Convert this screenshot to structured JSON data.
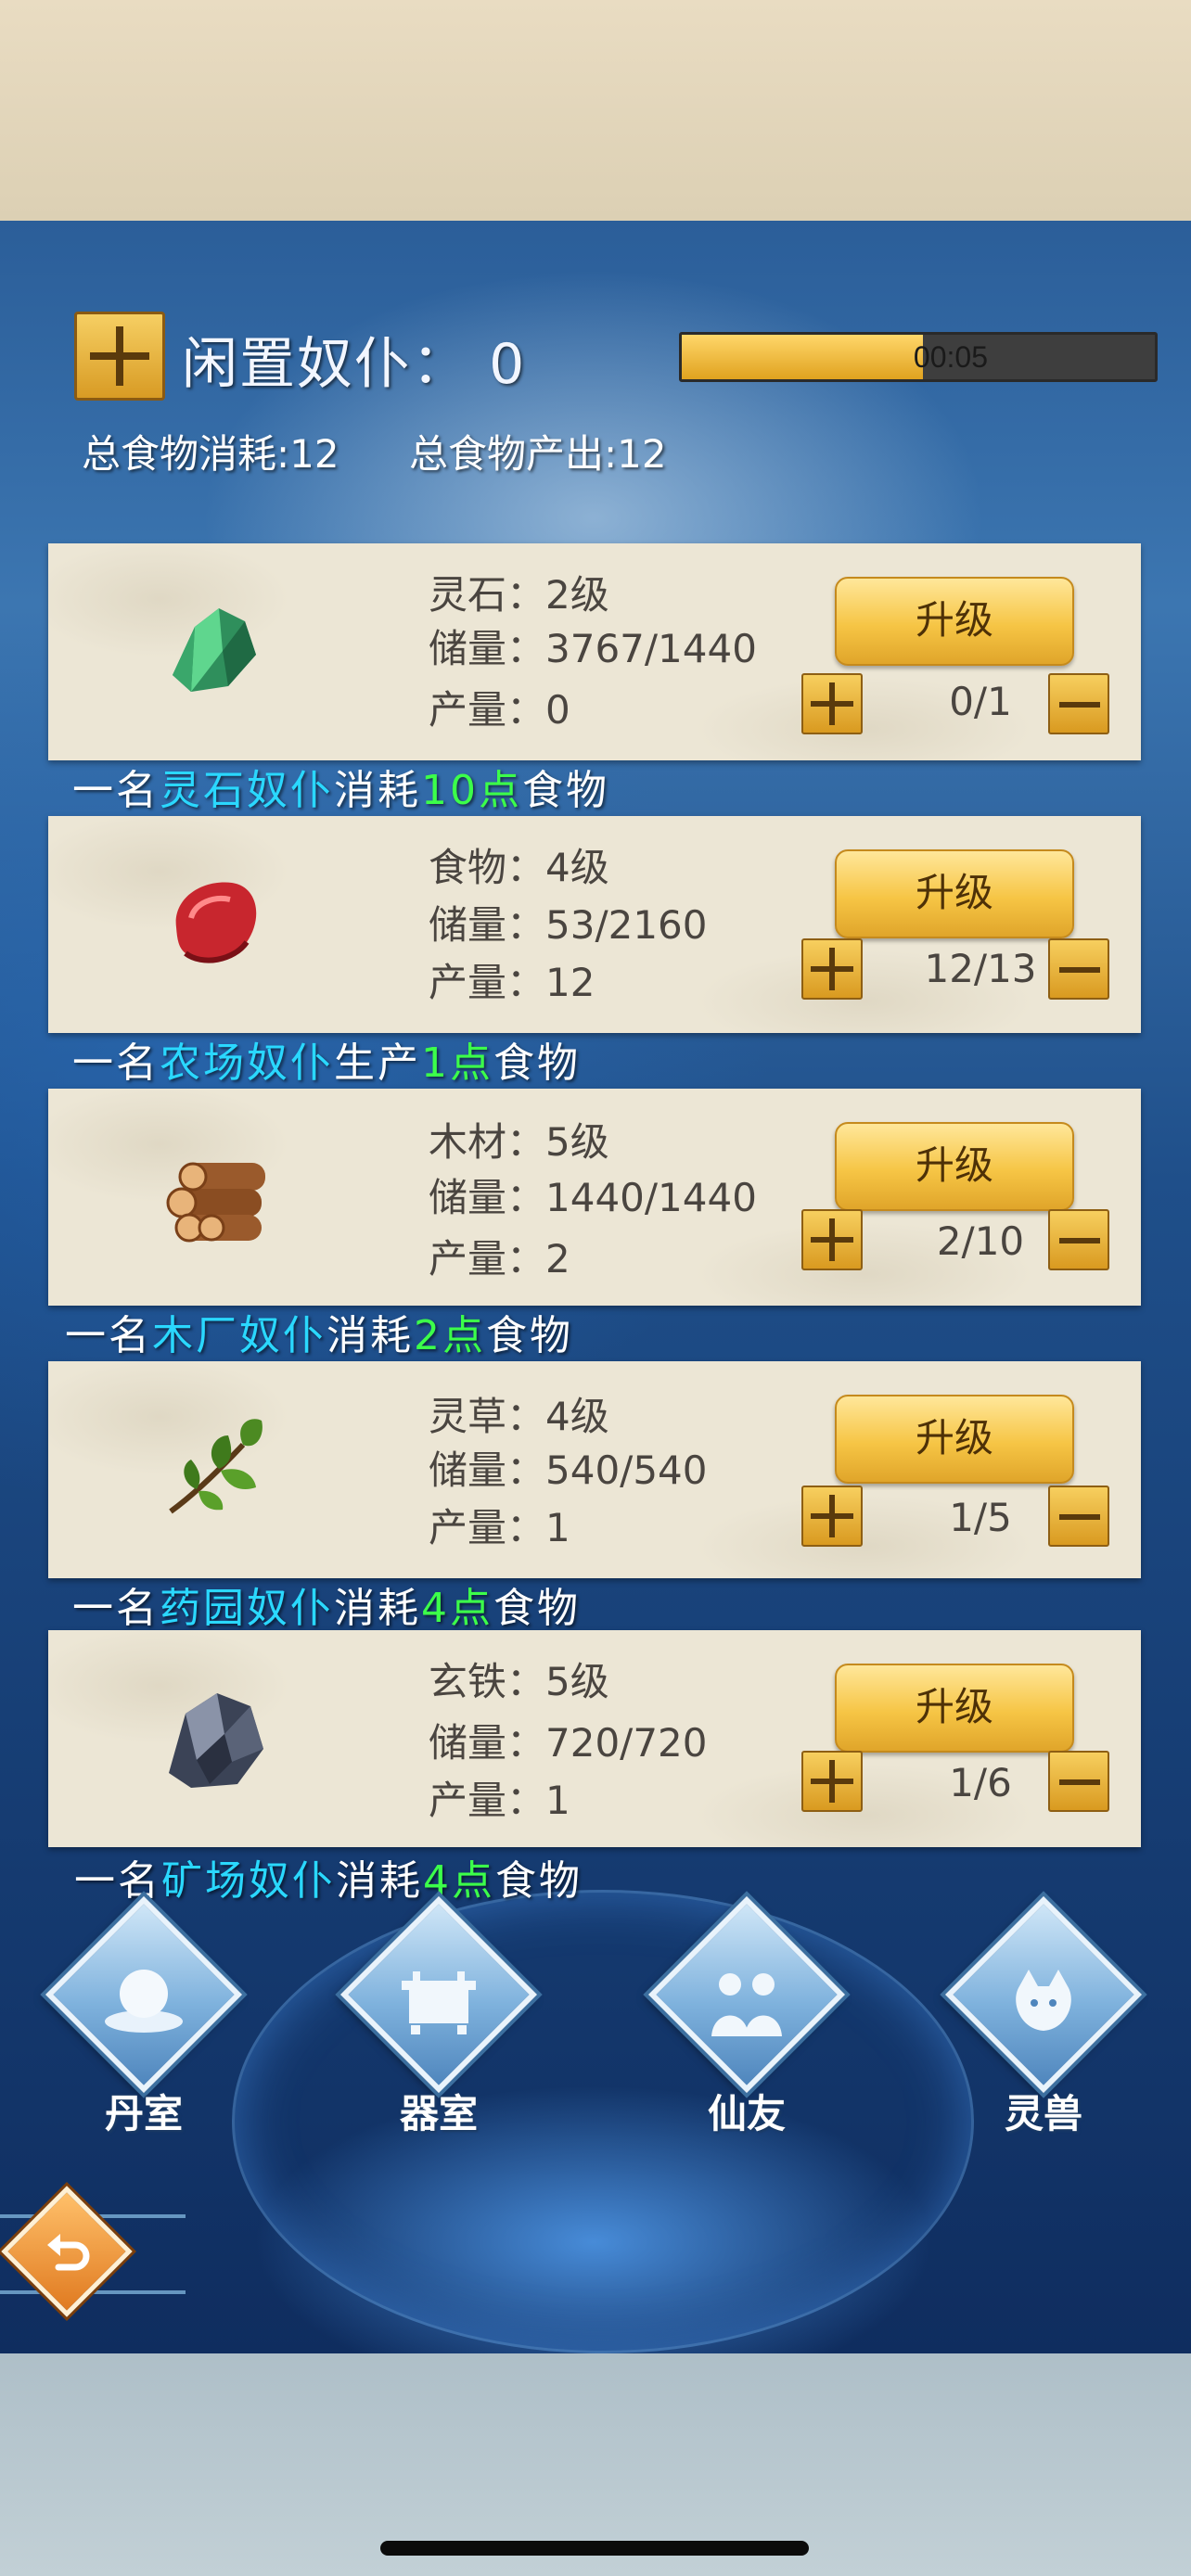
{
  "header": {
    "idle_label": "闲置奴仆：",
    "idle_count": "0",
    "timer": {
      "text": "00:05",
      "progress": 0.51
    },
    "total_consumption": "总食物消耗:12",
    "total_output": "总食物产出:12"
  },
  "upgrade_label": "升级",
  "resources": [
    {
      "icon": "spirit-stone-icon",
      "name_level": "灵石：2级",
      "storage": "储量：3767/1440",
      "output": "产量：0",
      "workers": "0/1",
      "line": {
        "prefix": "一名",
        "name": "灵石奴仆",
        "verb": "消耗",
        "amount": "10点",
        "suffix": "食物"
      }
    },
    {
      "icon": "meat-icon",
      "name_level": "食物：4级",
      "storage": "储量：53/2160",
      "output": "产量：12",
      "workers": "12/13",
      "line": {
        "prefix": "一名",
        "name": "农场奴仆",
        "verb": "生产",
        "amount": "1点",
        "suffix": "食物"
      }
    },
    {
      "icon": "wood-logs-icon",
      "name_level": "木材：5级",
      "storage": "储量：1440/1440",
      "output": "产量：2",
      "workers": "2/10",
      "line": {
        "prefix": "一名",
        "name": "木厂奴仆",
        "verb": "消耗",
        "amount": "2点",
        "suffix": "食物"
      }
    },
    {
      "icon": "herb-leaf-icon",
      "name_level": "灵草：4级",
      "storage": "储量：540/540",
      "output": "产量：1",
      "workers": "1/5",
      "line": {
        "prefix": "一名",
        "name": "药园奴仆",
        "verb": "消耗",
        "amount": "4点",
        "suffix": "食物"
      }
    },
    {
      "icon": "dark-iron-icon",
      "name_level": "玄铁：5级",
      "storage": "储量：720/720",
      "output": "产量：1",
      "workers": "1/6",
      "line": {
        "prefix": "一名",
        "name": "矿场奴仆",
        "verb": "消耗",
        "amount": "4点",
        "suffix": "食物"
      }
    }
  ],
  "nav": [
    {
      "icon": "alchemy-room-icon",
      "label": "丹室"
    },
    {
      "icon": "forge-room-icon",
      "label": "器室"
    },
    {
      "icon": "immortal-friends-icon",
      "label": "仙友"
    },
    {
      "icon": "spirit-beast-icon",
      "label": "灵兽"
    }
  ],
  "back_icon": "return-arrow-icon",
  "colors": {
    "worker_name": "#2ad8ff",
    "amount": "#3cff4a",
    "gold": "#f6c545"
  }
}
